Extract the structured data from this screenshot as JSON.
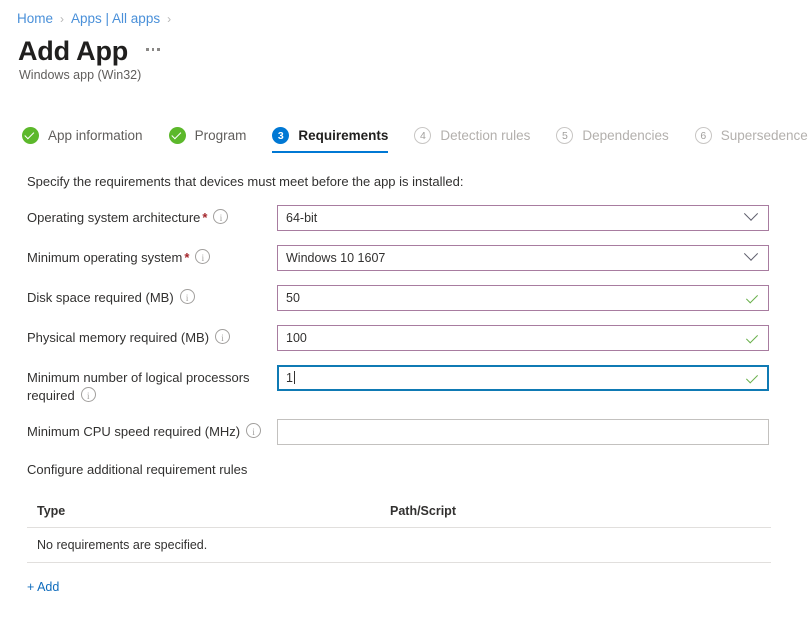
{
  "breadcrumb": {
    "items": [
      {
        "label": "Home"
      },
      {
        "label": "Apps | All apps"
      }
    ],
    "separator": "›"
  },
  "header": {
    "title": "Add App",
    "subtitle": "Windows app (Win32)",
    "more_menu": "ellipsis-menu"
  },
  "tabs": [
    {
      "label": "App information",
      "badge": "",
      "state": "done"
    },
    {
      "label": "Program",
      "badge": "",
      "state": "done"
    },
    {
      "label": "Requirements",
      "badge": "3",
      "state": "active"
    },
    {
      "label": "Detection rules",
      "badge": "4",
      "state": "pending"
    },
    {
      "label": "Dependencies",
      "badge": "5",
      "state": "pending"
    },
    {
      "label": "Supersedence",
      "badge": "6",
      "state": "pending"
    }
  ],
  "intro": "Specify the requirements that devices must meet before the app is installed:",
  "fields": [
    {
      "label": "Operating system architecture",
      "required": true,
      "info": true,
      "type": "dropdown",
      "value": "64-bit",
      "placeholder": ""
    },
    {
      "label": "Minimum operating system",
      "required": true,
      "info": true,
      "type": "dropdown",
      "value": "Windows 10 1607",
      "placeholder": ""
    },
    {
      "label": "Disk space required (MB)",
      "required": false,
      "info": true,
      "type": "text-valid",
      "value": "50",
      "placeholder": ""
    },
    {
      "label": "Physical memory required (MB)",
      "required": false,
      "info": true,
      "type": "text-valid",
      "value": "100",
      "placeholder": ""
    },
    {
      "label": "Minimum number of logical processors required",
      "required": false,
      "info": true,
      "type": "text-focused",
      "value": "1",
      "placeholder": ""
    },
    {
      "label": "Minimum CPU speed required (MHz)",
      "required": false,
      "info": true,
      "type": "text-empty",
      "value": "",
      "placeholder": ""
    }
  ],
  "rules": {
    "section_label": "Configure additional requirement rules",
    "columns": [
      "Type",
      "Path/Script"
    ],
    "empty_message": "No requirements are specified.",
    "add_label": "+ Add"
  },
  "colors": {
    "link": "#4a90d9",
    "accent": "#0078d4",
    "success": "#5cb82b",
    "required": "#a4262c",
    "validated_border": "#a87ca0",
    "focus_border": "#0f7ab4",
    "valid_check": "#6ab04c"
  }
}
